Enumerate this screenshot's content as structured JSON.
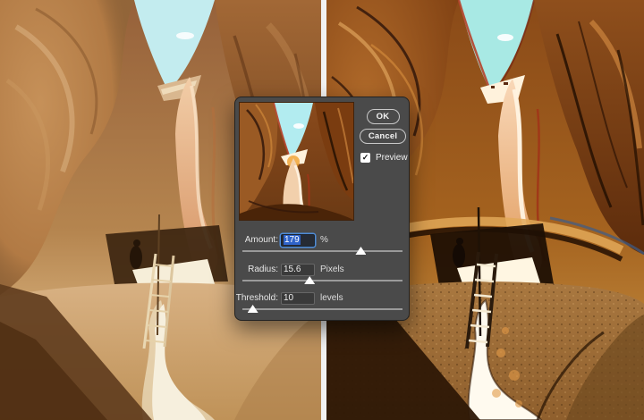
{
  "dialog": {
    "ok_label": "OK",
    "cancel_label": "Cancel",
    "preview": {
      "label": "Preview",
      "checked": true,
      "check_glyph": "✓"
    },
    "fields": [
      {
        "label": "Amount:",
        "value": "179",
        "unit": "%",
        "slider_percent": 74,
        "value_selected": true
      },
      {
        "label": "Radius:",
        "value": "15.6",
        "unit": "Pixels",
        "slider_percent": 42,
        "value_selected": false
      },
      {
        "label": "Threshold:",
        "value": "10",
        "unit": "levels",
        "slider_percent": 6.5,
        "value_selected": false
      }
    ]
  },
  "colors": {
    "dialog_bg": "#4a4a4a",
    "dialog_border": "#232323",
    "dialog_text": "#e8e8e8",
    "input_bg": "#3a3a3a",
    "input_border": "#666666",
    "focus_ring": "#4e8bd5",
    "selection_bg": "#2f63c9",
    "slider_track": "#9a9a9a",
    "slider_thumb": "#ffffff",
    "button_border": "#c9c9c9",
    "checkbox_bg": "#ffffff",
    "divider": "#f2f2f2"
  }
}
